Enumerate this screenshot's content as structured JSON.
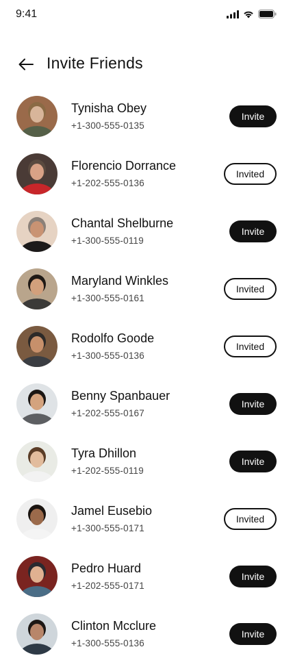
{
  "status": {
    "time": "9:41"
  },
  "header": {
    "title": "Invite Friends"
  },
  "contacts": [
    {
      "name": "Tynisha Obey",
      "phone": "+1-300-555-0135",
      "action": "Invite",
      "state": "invite",
      "skin": "#d8b59a",
      "hair": "#8a6a44",
      "bg": "#9a6a4a",
      "shirt": "#556048"
    },
    {
      "name": "Florencio Dorrance",
      "phone": "+1-202-555-0136",
      "action": "Invited",
      "state": "invited",
      "skin": "#d9a286",
      "hair": "#5a4a3f",
      "bg": "#4a3b36",
      "shirt": "#c8262a"
    },
    {
      "name": "Chantal Shelburne",
      "phone": "+1-300-555-0119",
      "action": "Invite",
      "state": "invite",
      "skin": "#c99373",
      "hair": "#8b8078",
      "bg": "#e6d3c3",
      "shirt": "#1c1a1a"
    },
    {
      "name": "Maryland Winkles",
      "phone": "+1-300-555-0161",
      "action": "Invited",
      "state": "invited",
      "skin": "#d2a07c",
      "hair": "#1f1915",
      "bg": "#b9a58c",
      "shirt": "#3b3a38"
    },
    {
      "name": "Rodolfo Goode",
      "phone": "+1-300-555-0136",
      "action": "Invited",
      "state": "invited",
      "skin": "#c7906b",
      "hair": "#2d2a28",
      "bg": "#7a5a40",
      "shirt": "#3a3d42"
    },
    {
      "name": "Benny Spanbauer",
      "phone": "+1-202-555-0167",
      "action": "Invite",
      "state": "invite",
      "skin": "#d4a37e",
      "hair": "#1c1714",
      "bg": "#dfe3e6",
      "shirt": "#5d5f62"
    },
    {
      "name": "Tyra Dhillon",
      "phone": "+1-202-555-0119",
      "action": "Invite",
      "state": "invite",
      "skin": "#e2bc9d",
      "hair": "#5b3d27",
      "bg": "#e9ebe5",
      "shirt": "#f2f2f2"
    },
    {
      "name": "Jamel Eusebio",
      "phone": "+1-300-555-0171",
      "action": "Invited",
      "state": "invited",
      "skin": "#9b6a4b",
      "hair": "#1a1410",
      "bg": "#efefef",
      "shirt": "#f4f4f4"
    },
    {
      "name": "Pedro Huard",
      "phone": "+1-202-555-0171",
      "action": "Invite",
      "state": "invite",
      "skin": "#e0b191",
      "hair": "#2a2a30",
      "bg": "#7a2420",
      "shirt": "#4a6d86"
    },
    {
      "name": "Clinton Mcclure",
      "phone": "+1-300-555-0136",
      "action": "Invite",
      "state": "invite",
      "skin": "#b8866a",
      "hair": "#1d1815",
      "bg": "#cfd6db",
      "shirt": "#2e3a46"
    }
  ]
}
